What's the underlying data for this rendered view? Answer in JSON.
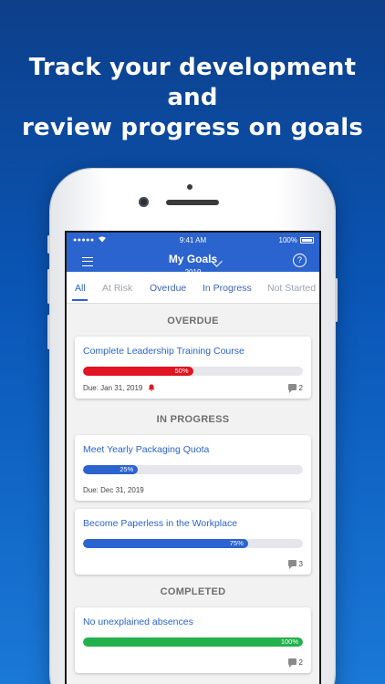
{
  "headline": [
    "Track  your development and",
    "review progress on goals"
  ],
  "status": {
    "dots": "●●●●●",
    "time": "9:41 AM",
    "battery": "100%"
  },
  "header": {
    "title": "My Goals",
    "year": "2019",
    "help": "?"
  },
  "tabs": [
    {
      "label": "All",
      "state": "active"
    },
    {
      "label": "At Risk",
      "state": "dim"
    },
    {
      "label": "Overdue",
      "state": "normal"
    },
    {
      "label": "In Progress",
      "state": "normal"
    },
    {
      "label": "Not Started",
      "state": "dim"
    }
  ],
  "sections": {
    "overdue": "OVERDUE",
    "in_progress": "IN PROGRESS",
    "completed": "COMPLETED"
  },
  "colors": {
    "primary": "#2b63cf",
    "overdue": "#e01422",
    "progress": "#2b63cf",
    "complete": "#22b14c"
  },
  "goals": [
    {
      "title": "Complete Leadership Training Course",
      "progress_percent": 50,
      "progress_label": "50%",
      "due": "Due: Jan 31, 2019",
      "comments": "2",
      "bar_color": "#e01422"
    },
    {
      "title": "Meet Yearly Packaging Quota",
      "progress_percent": 25,
      "progress_label": "25%",
      "due": "Due: Dec 31, 2019",
      "comments": "",
      "bar_color": "#2b63cf"
    },
    {
      "title": "Become Paperless in the Workplace",
      "progress_percent": 75,
      "progress_label": "75%",
      "due": "",
      "comments": "3",
      "bar_color": "#2b63cf"
    },
    {
      "title": "No unexplained absences",
      "progress_percent": 100,
      "progress_label": "100%",
      "due": "",
      "comments": "2",
      "bar_color": "#22b14c"
    }
  ]
}
